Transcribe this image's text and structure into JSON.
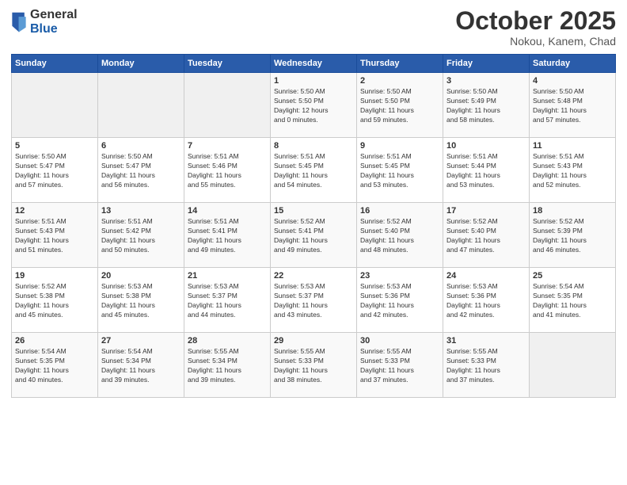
{
  "header": {
    "logo_general": "General",
    "logo_blue": "Blue",
    "month": "October 2025",
    "location": "Nokou, Kanem, Chad"
  },
  "weekdays": [
    "Sunday",
    "Monday",
    "Tuesday",
    "Wednesday",
    "Thursday",
    "Friday",
    "Saturday"
  ],
  "weeks": [
    [
      {
        "day": "",
        "info": ""
      },
      {
        "day": "",
        "info": ""
      },
      {
        "day": "",
        "info": ""
      },
      {
        "day": "1",
        "info": "Sunrise: 5:50 AM\nSunset: 5:50 PM\nDaylight: 12 hours\nand 0 minutes."
      },
      {
        "day": "2",
        "info": "Sunrise: 5:50 AM\nSunset: 5:50 PM\nDaylight: 11 hours\nand 59 minutes."
      },
      {
        "day": "3",
        "info": "Sunrise: 5:50 AM\nSunset: 5:49 PM\nDaylight: 11 hours\nand 58 minutes."
      },
      {
        "day": "4",
        "info": "Sunrise: 5:50 AM\nSunset: 5:48 PM\nDaylight: 11 hours\nand 57 minutes."
      }
    ],
    [
      {
        "day": "5",
        "info": "Sunrise: 5:50 AM\nSunset: 5:47 PM\nDaylight: 11 hours\nand 57 minutes."
      },
      {
        "day": "6",
        "info": "Sunrise: 5:50 AM\nSunset: 5:47 PM\nDaylight: 11 hours\nand 56 minutes."
      },
      {
        "day": "7",
        "info": "Sunrise: 5:51 AM\nSunset: 5:46 PM\nDaylight: 11 hours\nand 55 minutes."
      },
      {
        "day": "8",
        "info": "Sunrise: 5:51 AM\nSunset: 5:45 PM\nDaylight: 11 hours\nand 54 minutes."
      },
      {
        "day": "9",
        "info": "Sunrise: 5:51 AM\nSunset: 5:45 PM\nDaylight: 11 hours\nand 53 minutes."
      },
      {
        "day": "10",
        "info": "Sunrise: 5:51 AM\nSunset: 5:44 PM\nDaylight: 11 hours\nand 53 minutes."
      },
      {
        "day": "11",
        "info": "Sunrise: 5:51 AM\nSunset: 5:43 PM\nDaylight: 11 hours\nand 52 minutes."
      }
    ],
    [
      {
        "day": "12",
        "info": "Sunrise: 5:51 AM\nSunset: 5:43 PM\nDaylight: 11 hours\nand 51 minutes."
      },
      {
        "day": "13",
        "info": "Sunrise: 5:51 AM\nSunset: 5:42 PM\nDaylight: 11 hours\nand 50 minutes."
      },
      {
        "day": "14",
        "info": "Sunrise: 5:51 AM\nSunset: 5:41 PM\nDaylight: 11 hours\nand 49 minutes."
      },
      {
        "day": "15",
        "info": "Sunrise: 5:52 AM\nSunset: 5:41 PM\nDaylight: 11 hours\nand 49 minutes."
      },
      {
        "day": "16",
        "info": "Sunrise: 5:52 AM\nSunset: 5:40 PM\nDaylight: 11 hours\nand 48 minutes."
      },
      {
        "day": "17",
        "info": "Sunrise: 5:52 AM\nSunset: 5:40 PM\nDaylight: 11 hours\nand 47 minutes."
      },
      {
        "day": "18",
        "info": "Sunrise: 5:52 AM\nSunset: 5:39 PM\nDaylight: 11 hours\nand 46 minutes."
      }
    ],
    [
      {
        "day": "19",
        "info": "Sunrise: 5:52 AM\nSunset: 5:38 PM\nDaylight: 11 hours\nand 45 minutes."
      },
      {
        "day": "20",
        "info": "Sunrise: 5:53 AM\nSunset: 5:38 PM\nDaylight: 11 hours\nand 45 minutes."
      },
      {
        "day": "21",
        "info": "Sunrise: 5:53 AM\nSunset: 5:37 PM\nDaylight: 11 hours\nand 44 minutes."
      },
      {
        "day": "22",
        "info": "Sunrise: 5:53 AM\nSunset: 5:37 PM\nDaylight: 11 hours\nand 43 minutes."
      },
      {
        "day": "23",
        "info": "Sunrise: 5:53 AM\nSunset: 5:36 PM\nDaylight: 11 hours\nand 42 minutes."
      },
      {
        "day": "24",
        "info": "Sunrise: 5:53 AM\nSunset: 5:36 PM\nDaylight: 11 hours\nand 42 minutes."
      },
      {
        "day": "25",
        "info": "Sunrise: 5:54 AM\nSunset: 5:35 PM\nDaylight: 11 hours\nand 41 minutes."
      }
    ],
    [
      {
        "day": "26",
        "info": "Sunrise: 5:54 AM\nSunset: 5:35 PM\nDaylight: 11 hours\nand 40 minutes."
      },
      {
        "day": "27",
        "info": "Sunrise: 5:54 AM\nSunset: 5:34 PM\nDaylight: 11 hours\nand 39 minutes."
      },
      {
        "day": "28",
        "info": "Sunrise: 5:55 AM\nSunset: 5:34 PM\nDaylight: 11 hours\nand 39 minutes."
      },
      {
        "day": "29",
        "info": "Sunrise: 5:55 AM\nSunset: 5:33 PM\nDaylight: 11 hours\nand 38 minutes."
      },
      {
        "day": "30",
        "info": "Sunrise: 5:55 AM\nSunset: 5:33 PM\nDaylight: 11 hours\nand 37 minutes."
      },
      {
        "day": "31",
        "info": "Sunrise: 5:55 AM\nSunset: 5:33 PM\nDaylight: 11 hours\nand 37 minutes."
      },
      {
        "day": "",
        "info": ""
      }
    ]
  ]
}
